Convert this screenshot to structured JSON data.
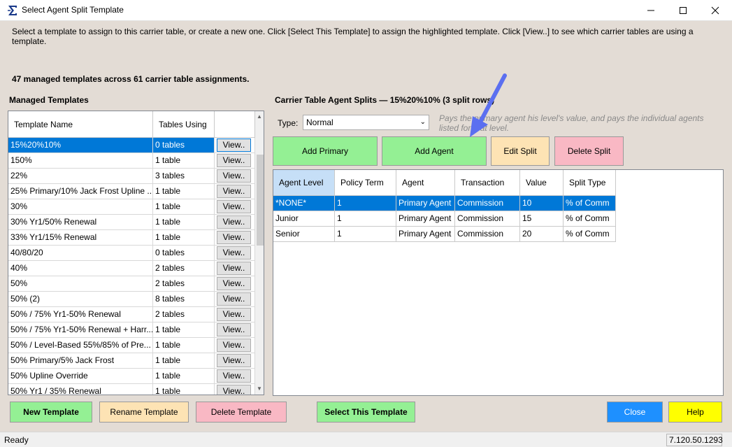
{
  "window": {
    "title": "Select Agent Split Template"
  },
  "instructions": "Select a template to assign to this carrier table, or create a new one. Click [Select This Template] to assign the highlighted template. Click [View..] to see which carrier tables are using a template.",
  "summary": "47 managed templates across 61 carrier table assignments.",
  "templates_panel": {
    "label": "Managed Templates",
    "columns": [
      "Template Name",
      "Tables Using",
      ""
    ],
    "view_label": "View..",
    "rows": [
      {
        "name": "15%20%10%",
        "tables": "0 tables",
        "selected": true
      },
      {
        "name": "150%",
        "tables": "1 table"
      },
      {
        "name": "22%",
        "tables": "3 tables"
      },
      {
        "name": "25% Primary/10% Jack Frost Upline ...",
        "tables": "1 table"
      },
      {
        "name": "30%",
        "tables": "1 table"
      },
      {
        "name": "30% Yr1/50% Renewal",
        "tables": "1 table"
      },
      {
        "name": "33% Yr1/15% Renewal",
        "tables": "1 table"
      },
      {
        "name": "40/80/20",
        "tables": "0 tables"
      },
      {
        "name": "40%",
        "tables": "2 tables"
      },
      {
        "name": "50%",
        "tables": "2 tables"
      },
      {
        "name": "50% (2)",
        "tables": "8 tables"
      },
      {
        "name": "50% / 75% Yr1-50% Renewal",
        "tables": "2 tables"
      },
      {
        "name": "50% / 75% Yr1-50% Renewal + Harr...",
        "tables": "1 table"
      },
      {
        "name": "50% / Level-Based 55%/85% of Pre...",
        "tables": "1 table"
      },
      {
        "name": "50% Primary/5% Jack Frost",
        "tables": "1 table"
      },
      {
        "name": "50% Upline Override",
        "tables": "1 table"
      },
      {
        "name": "50% Yr1 / 35% Renewal",
        "tables": "1 table"
      }
    ]
  },
  "splits_panel": {
    "label": "Carrier Table Agent Splits — 15%20%10%  (3 split rows)",
    "type_label": "Type:",
    "type_value": "Normal",
    "type_description": "Pays the primary agent his level's value, and pays the individual agents listed for that level.",
    "buttons": {
      "add_primary": "Add Primary",
      "add_agent": "Add Agent",
      "edit_split": "Edit Split",
      "delete_split": "Delete Split"
    },
    "columns": [
      "Agent Level",
      "Policy Term",
      "Agent",
      "Transaction",
      "Value",
      "Split Type"
    ],
    "rows": [
      {
        "level": "*NONE*",
        "term": "1",
        "agent": "Primary Agent",
        "transaction": "Commission",
        "value": "10",
        "split_type": "% of Comm",
        "selected": true
      },
      {
        "level": "Junior",
        "term": "1",
        "agent": "Primary Agent",
        "transaction": "Commission",
        "value": "15",
        "split_type": "% of Comm"
      },
      {
        "level": "Senior",
        "term": "1",
        "agent": "Primary Agent",
        "transaction": "Commission",
        "value": "20",
        "split_type": "% of Comm"
      }
    ]
  },
  "bottom_buttons": {
    "new_template": "New Template",
    "rename_template": "Rename Template",
    "delete_template": "Delete Template",
    "select_template": "Select This Template",
    "close": "Close",
    "help": "Help"
  },
  "statusbar": {
    "status": "Ready",
    "version": "7.120.50.1293"
  },
  "colors": {
    "green": "#94f094",
    "peach": "#fde3b4",
    "pink": "#f9b8c4",
    "blue": "#1e90ff",
    "yellow": "#ffff00",
    "selection": "#0078d7",
    "annotation_arrow": "#5b6ff0"
  },
  "icons": [
    "app-sigma-icon",
    "minimize-icon",
    "maximize-icon",
    "close-icon",
    "chevron-down-icon",
    "scroll-up-icon",
    "scroll-down-icon"
  ]
}
